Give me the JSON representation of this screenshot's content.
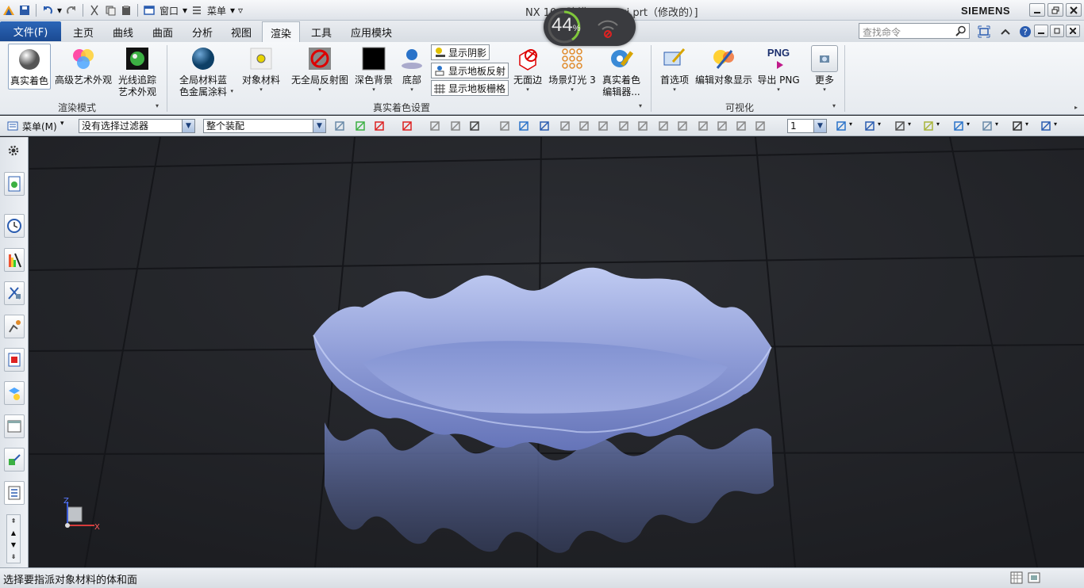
{
  "window": {
    "title": "NX 10 - 建模 - [panzi.prt（修改的）]",
    "brand": "SIEMENS",
    "quick_access": {
      "window_menu": "窗口",
      "menu_label": "菜单"
    }
  },
  "perf_gauge": {
    "percent": "44",
    "unit": "%"
  },
  "tabs": {
    "file": "文件(F)",
    "items": [
      "主页",
      "曲线",
      "曲面",
      "分析",
      "视图",
      "渲染",
      "工具",
      "应用模块"
    ],
    "active": "渲染"
  },
  "search": {
    "placeholder": "查找命令"
  },
  "ribbon": {
    "render_mode": {
      "label": "渲染模式",
      "buttons": [
        "真实着色",
        "高级艺术外观",
        "光线追踪\n艺术外观"
      ]
    },
    "true_shading": {
      "label": "真实着色设置",
      "global_material": "全局材料蓝\n色金属涂料",
      "object_material": "对象材料",
      "no_reflection": "无全局反射图",
      "dark_bg": "深色背景",
      "floor": "底部",
      "show_shadow": "显示阴影",
      "show_floor_reflection": "显示地板反射",
      "show_floor_grid": "显示地板栅格",
      "no_edges": "无面边",
      "scene_light": "场景灯光 3",
      "editor": "真实着色\n编辑器..."
    },
    "visualization": {
      "label": "可视化",
      "preferences": "首选项",
      "edit_display": "编辑对象显示",
      "export_png": "导出 PNG",
      "more": "更多",
      "png_badge": "PNG"
    }
  },
  "toolbar": {
    "menu_label": "菜单(M)",
    "filter": "没有选择过滤器",
    "scope": "整个装配",
    "layer": "1"
  },
  "viewport": {
    "triad": {
      "z": "Z",
      "x": "X"
    }
  },
  "statusbar": {
    "message": "选择要指派对象材料的体和面"
  },
  "colors": {
    "accent": "#1b4a92",
    "viewport_bg": "#222428",
    "model": "#8f9fd8"
  }
}
